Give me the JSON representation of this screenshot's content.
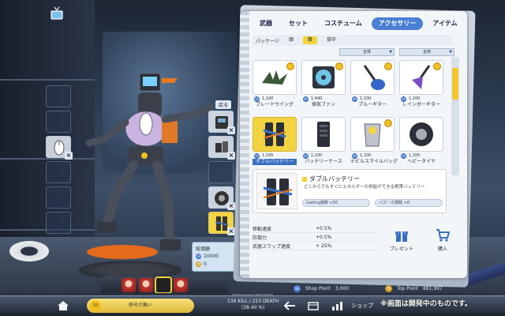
{
  "tabs": [
    {
      "label": "武器",
      "active": false
    },
    {
      "label": "セット",
      "active": false
    },
    {
      "label": "コスチューム",
      "active": false
    },
    {
      "label": "アクセサリー",
      "active": true
    },
    {
      "label": "アイテム",
      "active": false
    }
  ],
  "package": {
    "label": "パッケージ",
    "tabs": [
      {
        "label": "頭",
        "active": false
      },
      {
        "label": "腰",
        "active": true
      },
      {
        "label": "背中",
        "active": false
      }
    ]
  },
  "filters": [
    "全体",
    "全体"
  ],
  "items": [
    {
      "name": "ブレードウイング",
      "price": "1,100",
      "selected": false,
      "icon": "blade-wing-icon"
    },
    {
      "name": "換気ファン",
      "price": "1,440",
      "selected": false,
      "icon": "fan-icon"
    },
    {
      "name": "ブルーギター",
      "price": "1,100",
      "selected": false,
      "icon": "blue-guitar-icon"
    },
    {
      "name": "レインボーギター",
      "price": "1,100",
      "selected": false,
      "icon": "rainbow-guitar-icon"
    },
    {
      "name": "ダブルバッテリー",
      "price": "1,100",
      "selected": true,
      "icon": "battery-icon"
    },
    {
      "name": "バッテリーケース",
      "price": "1,100",
      "selected": false,
      "icon": "battery-case-icon"
    },
    {
      "name": "デビルスマイルバッグ",
      "price": "1,100",
      "selected": false,
      "icon": "smile-bag-icon"
    },
    {
      "name": "ヘビータイヤ",
      "price": "1,100",
      "selected": false,
      "icon": "tire-icon"
    }
  ],
  "detail": {
    "title": "ダブルバッテリー",
    "description": "どこからでもすぐにエネルギーの供給ができる携帯バッテリー",
    "bonuses": [
      "Gatling弾数 +50",
      "バズーカ弾数 +6"
    ]
  },
  "stats": [
    {
      "label": "移動速度",
      "value": "+0.5%"
    },
    {
      "label": "防御力",
      "value": "+0.5%"
    },
    {
      "label": "武器スワップ速度",
      "value": "+ 25%"
    }
  ],
  "actions": {
    "gift": "プレゼント",
    "buy": "購入"
  },
  "points": {
    "sp_label": "Shop Point",
    "sp_value": "3,000",
    "tp_label": "Top Point",
    "tp_value": "881,997"
  },
  "hint": {
    "title": "総価額",
    "sp": "10000",
    "tp": "0"
  },
  "return_label": "戻る",
  "bottom": {
    "exp": "EXP 0017144.05 % [NEXT 657561]",
    "nameplate": "称号が無い",
    "level": "10",
    "kd_line1": "139 KILL / 223 DEATH",
    "kd_line2": "(38.40 %)",
    "shop": "ショップ",
    "notice": "※画面は開発中のものです。"
  },
  "colors": {
    "accent": "#4a7fd4",
    "selected": "#f2d341",
    "sp": "#3a6fc0",
    "tp": "#d1a12a"
  }
}
